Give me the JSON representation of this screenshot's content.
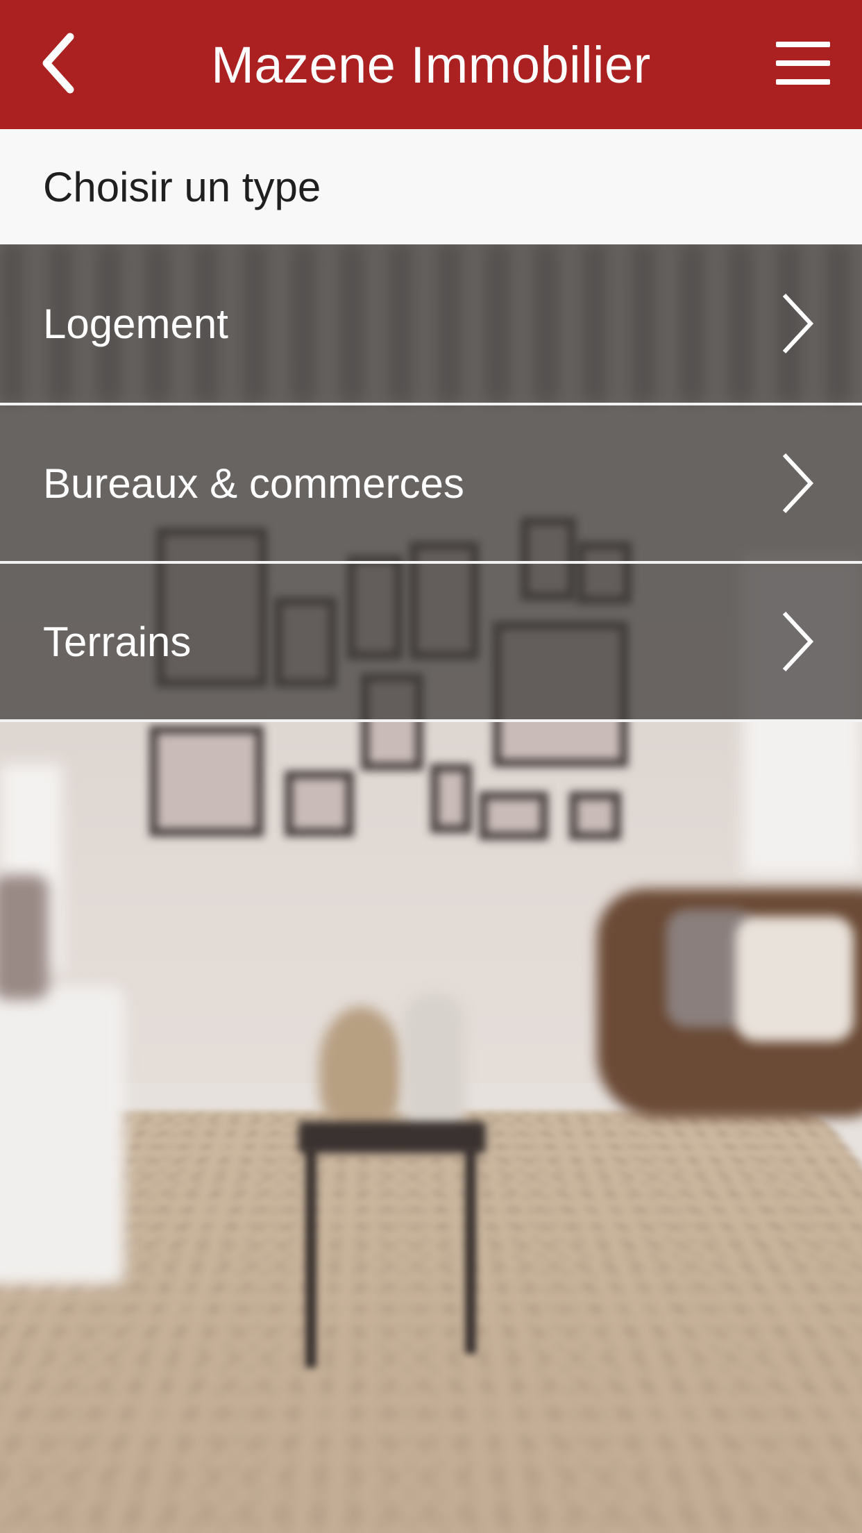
{
  "app_bar": {
    "title": "Mazene Immobilier",
    "back_icon": "chevron-left-icon",
    "menu_icon": "hamburger-menu-icon",
    "background_color": "#ab2020"
  },
  "subheader": {
    "label": "Choisir un type"
  },
  "categories": [
    {
      "label": "Logement"
    },
    {
      "label": "Bureaux & commerces"
    },
    {
      "label": "Terrains"
    }
  ]
}
